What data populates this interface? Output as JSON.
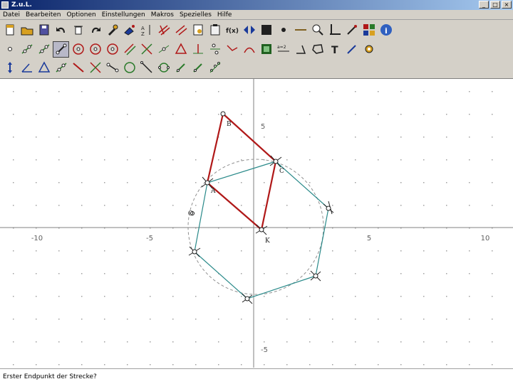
{
  "window": {
    "title": "Z.u.L."
  },
  "menu": [
    "Datei",
    "Bearbeiten",
    "Optionen",
    "Einstellungen",
    "Makros",
    "Spezielles",
    "Hilfe"
  ],
  "toolbar": {
    "row1": [
      {
        "name": "new-file-icon",
        "glyph": "new"
      },
      {
        "name": "open-folder-icon",
        "glyph": "open"
      },
      {
        "name": "save-icon",
        "glyph": "save"
      },
      {
        "name": "undo-icon",
        "glyph": "undo"
      },
      {
        "name": "delete-icon",
        "glyph": "trash"
      },
      {
        "name": "redo-icon",
        "glyph": "redo"
      },
      {
        "name": "edit-tool-icon",
        "glyph": "tool"
      },
      {
        "name": "color-tool-icon",
        "glyph": "paint"
      },
      {
        "name": "sort-icon",
        "glyph": "sort"
      },
      {
        "name": "grid-icon",
        "glyph": "hash"
      },
      {
        "name": "hash-icon",
        "glyph": "hash2"
      },
      {
        "name": "properties-icon",
        "glyph": "props"
      },
      {
        "name": "clipboard-icon",
        "glyph": "clip"
      },
      {
        "name": "function-icon",
        "glyph": "fx"
      },
      {
        "name": "arrows-icon",
        "glyph": "arrows"
      },
      {
        "name": "black-square-icon",
        "glyph": "square"
      },
      {
        "name": "dot-icon",
        "glyph": "dot"
      },
      {
        "name": "line-color-icon",
        "glyph": "hline"
      },
      {
        "name": "zoom-icon",
        "glyph": "zoom"
      },
      {
        "name": "axes-icon",
        "glyph": "axes"
      },
      {
        "name": "magic-wand-icon",
        "glyph": "wand"
      },
      {
        "name": "color-palette-icon",
        "glyph": "palette"
      },
      {
        "name": "info-icon",
        "glyph": "info"
      }
    ],
    "row2": [
      {
        "name": "point-icon",
        "glyph": "p"
      },
      {
        "name": "line-icon",
        "glyph": "l"
      },
      {
        "name": "ray-icon",
        "glyph": "l"
      },
      {
        "name": "segment-icon",
        "glyph": "seg",
        "selected": true
      },
      {
        "name": "circle-icon",
        "glyph": "c"
      },
      {
        "name": "circle-radius-icon",
        "glyph": "c"
      },
      {
        "name": "circle-3pt-icon",
        "glyph": "c"
      },
      {
        "name": "parallel-icon",
        "glyph": "par"
      },
      {
        "name": "intersection-icon",
        "glyph": "x"
      },
      {
        "name": "midpoint-icon",
        "glyph": "mid"
      },
      {
        "name": "triangle-icon",
        "glyph": "tri"
      },
      {
        "name": "perpendicular-icon",
        "glyph": "perp"
      },
      {
        "name": "reflect-icon",
        "glyph": "refl"
      },
      {
        "name": "bend-icon",
        "glyph": "bend"
      },
      {
        "name": "curve-icon",
        "glyph": "curve"
      },
      {
        "name": "film-icon",
        "glyph": "film"
      },
      {
        "name": "equation-icon",
        "glyph": "eq"
      },
      {
        "name": "angle-icon",
        "glyph": "ang"
      },
      {
        "name": "polygon-icon",
        "glyph": "poly"
      },
      {
        "name": "text-tool-icon",
        "glyph": "T"
      },
      {
        "name": "wand-icon",
        "glyph": "wand2"
      },
      {
        "name": "gear-icon",
        "glyph": "gear"
      }
    ],
    "row3": [
      {
        "name": "move-icon",
        "glyph": "move"
      },
      {
        "name": "angle-mark-icon",
        "glyph": "ang2"
      },
      {
        "name": "triangle-tool-icon",
        "glyph": "tri2"
      },
      {
        "name": "segment-tool-icon",
        "glyph": "l"
      },
      {
        "name": "line-red-icon",
        "glyph": "lr"
      },
      {
        "name": "cross-icon",
        "glyph": "x"
      },
      {
        "name": "segment-2-icon",
        "glyph": "seg2"
      },
      {
        "name": "circle-tool-icon",
        "glyph": "c2"
      },
      {
        "name": "diagonal-icon",
        "glyph": "diag"
      },
      {
        "name": "circle-dots-icon",
        "glyph": "c3"
      },
      {
        "name": "pencil-icon",
        "glyph": "pen"
      },
      {
        "name": "pencil-2-icon",
        "glyph": "pen"
      },
      {
        "name": "points-icon",
        "glyph": "pts"
      }
    ]
  },
  "canvas": {
    "x_ticks": [
      "-10",
      "-5",
      "5",
      "10"
    ],
    "y_ticks": [
      "5",
      "-5"
    ],
    "point_labels": [
      "B",
      "C",
      "A",
      "K",
      "O"
    ]
  },
  "colors": {
    "segment": "#b01818",
    "polygon": "#2a8a8a",
    "circle": "#909090",
    "axis": "#808080"
  },
  "status": {
    "text": "Erster Endpunkt der Strecke?"
  }
}
